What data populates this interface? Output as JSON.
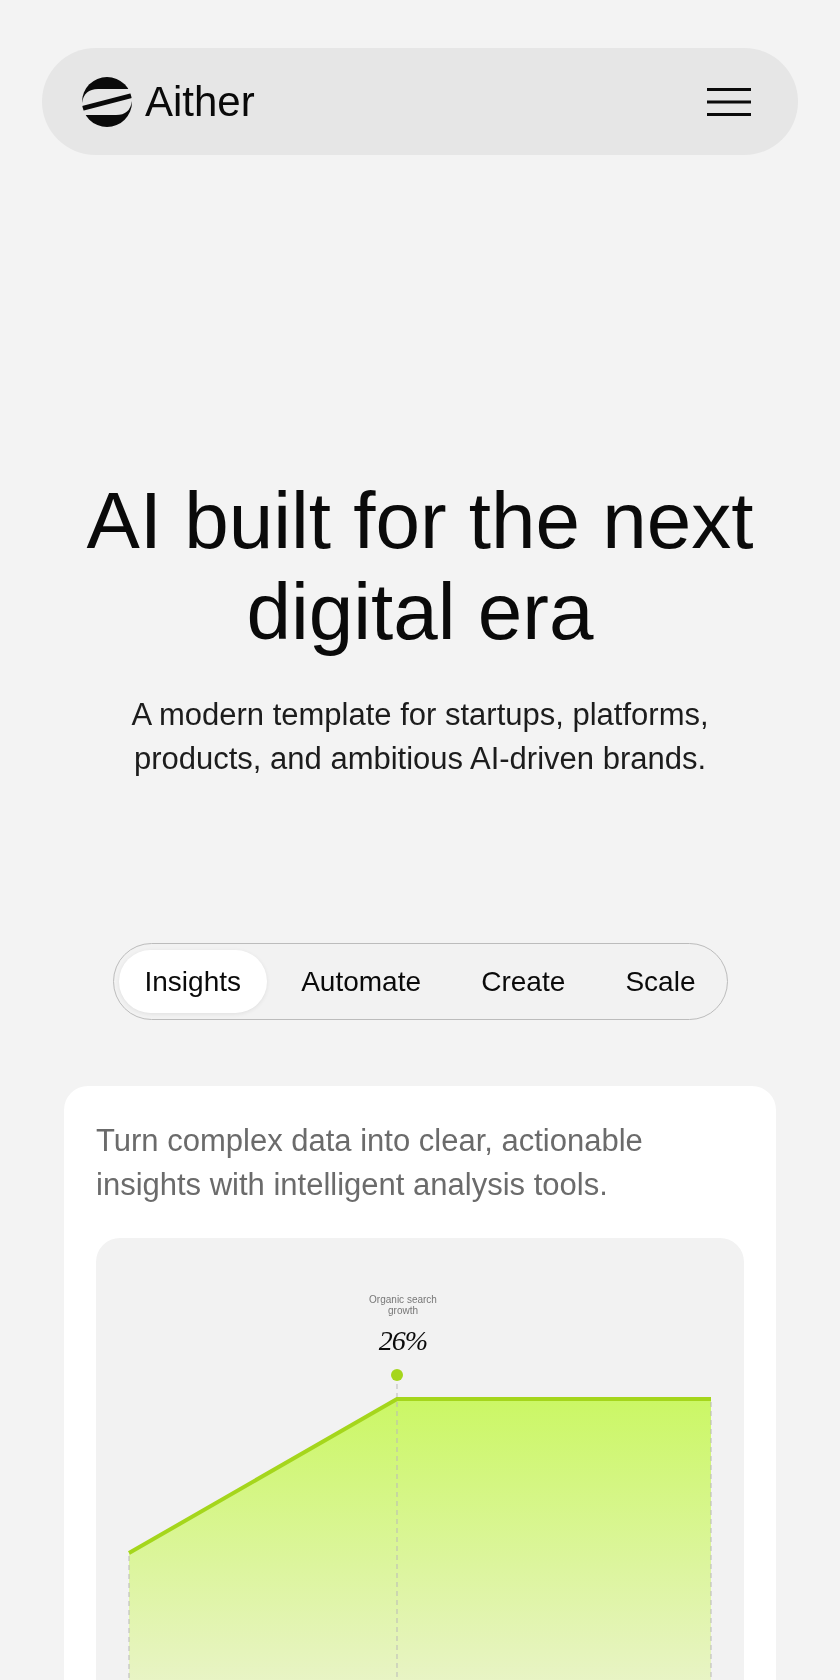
{
  "header": {
    "brand": "Aither"
  },
  "hero": {
    "title": "AI built for the next digital era",
    "subtitle": "A modern template for startups, platforms, products, and ambitious AI-driven brands."
  },
  "tabs": [
    {
      "label": "Insights",
      "selected": true
    },
    {
      "label": "Automate",
      "selected": false
    },
    {
      "label": "Create",
      "selected": false
    },
    {
      "label": "Scale",
      "selected": false
    }
  ],
  "card": {
    "description": "Turn complex data into clear, actionable insights with intelligent analysis tools.",
    "chart": {
      "label": "Organic search growth",
      "value": "26%"
    }
  }
}
